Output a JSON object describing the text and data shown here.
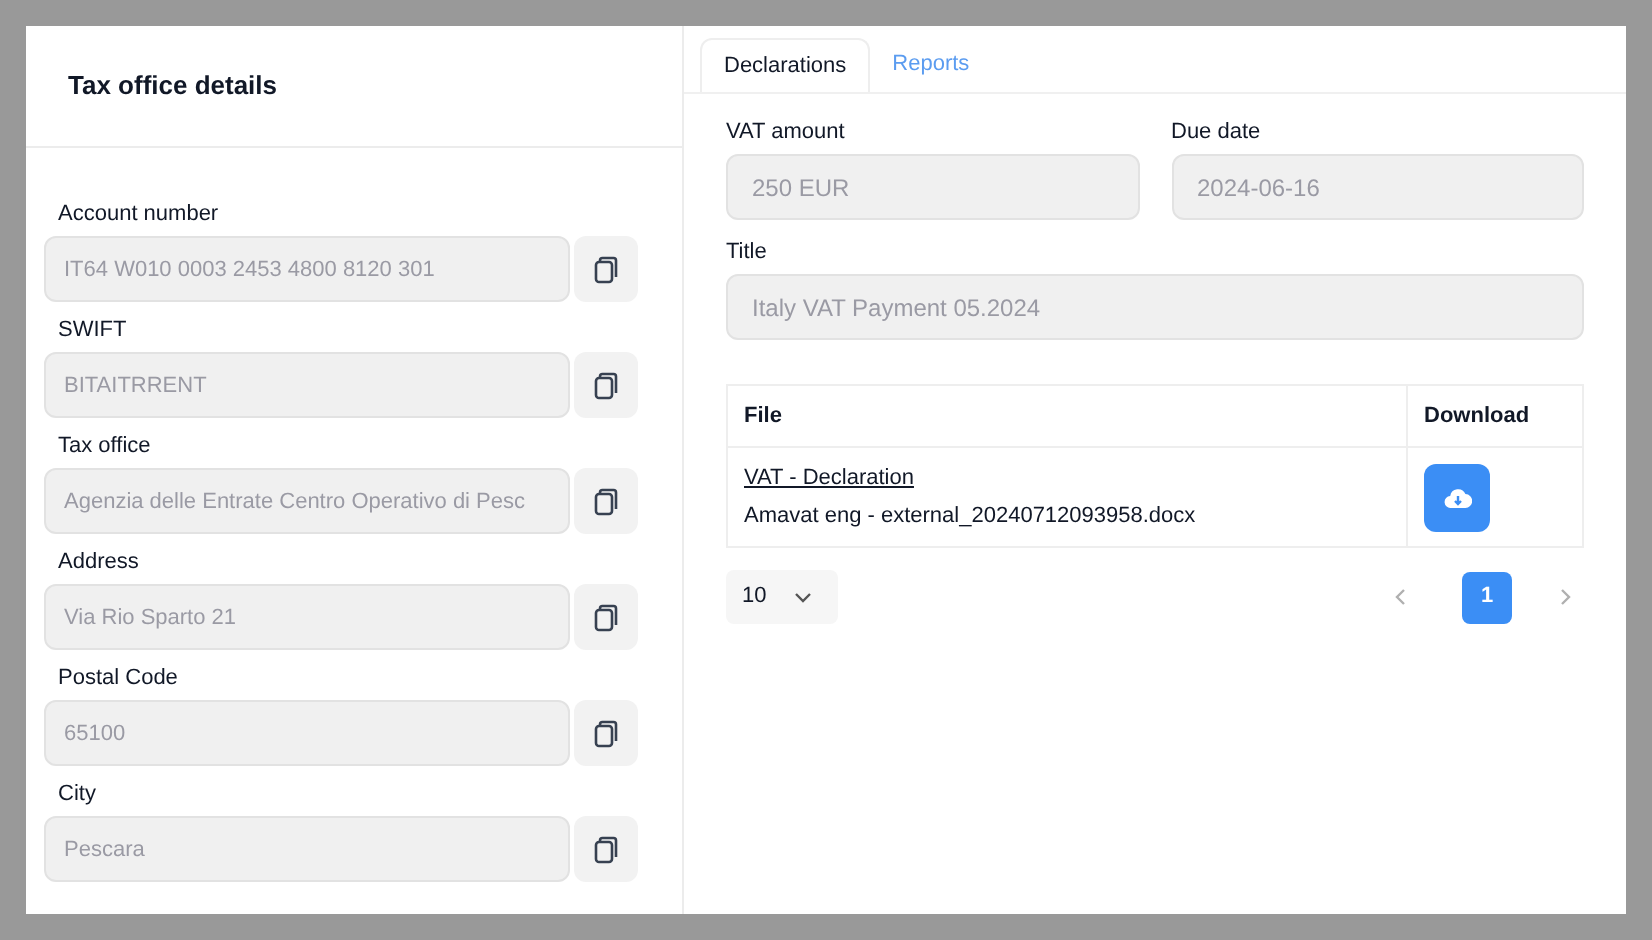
{
  "left_panel": {
    "title": "Tax office details",
    "fields": [
      {
        "label": "Account number",
        "value": "IT64 W010 0003 2453 4800 8120 301"
      },
      {
        "label": "SWIFT",
        "value": "BITAITRRENT"
      },
      {
        "label": "Tax office",
        "value": "Agenzia delle Entrate Centro Operativo di Pesc"
      },
      {
        "label": "Address",
        "value": "Via Rio Sparto 21"
      },
      {
        "label": "Postal Code",
        "value": "65100"
      },
      {
        "label": "City",
        "value": "Pescara"
      }
    ]
  },
  "tabs": [
    {
      "label": "Declarations",
      "selected": true
    },
    {
      "label": "Reports",
      "selected": false
    }
  ],
  "form": {
    "vat_amount": {
      "label": "VAT amount",
      "value": "250 EUR"
    },
    "due_date": {
      "label": "Due date",
      "value": "2024-06-16"
    },
    "title": {
      "label": "Title",
      "value": "Italy VAT Payment 05.2024"
    }
  },
  "table": {
    "columns": [
      "File",
      "Download"
    ],
    "rows": [
      {
        "link": "VAT - Declaration",
        "filename": "Amavat eng - external_20240712093958.docx"
      }
    ]
  },
  "pagination": {
    "page_size": "10",
    "pages": [
      {
        "label": "1",
        "selected": true
      }
    ]
  }
}
